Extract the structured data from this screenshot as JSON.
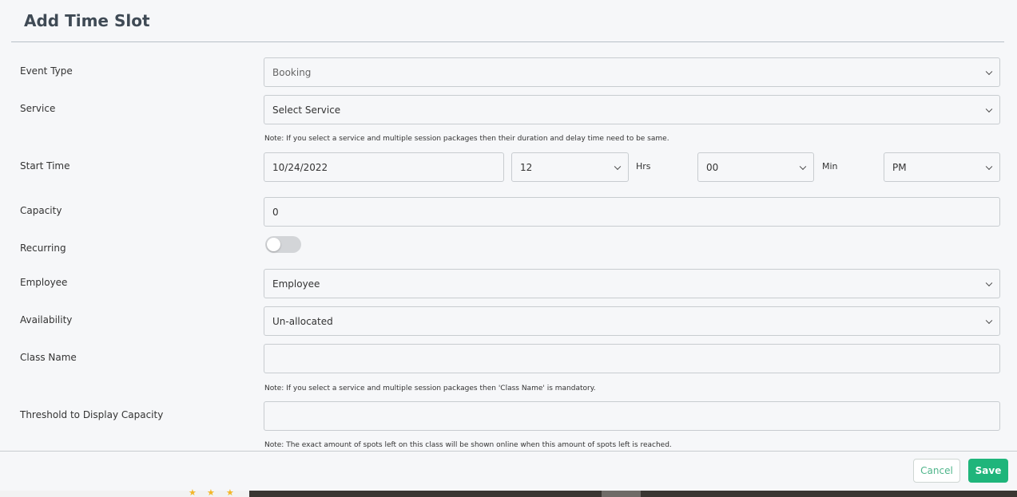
{
  "modal": {
    "title": "Add Time Slot"
  },
  "form": {
    "event_type": {
      "label": "Event Type",
      "value": "Booking"
    },
    "service": {
      "label": "Service",
      "value": "Select Service",
      "note": "Note: If you select a service and multiple session packages then their duration and delay time need to be same."
    },
    "start_time": {
      "label": "Start Time",
      "date": "10/24/2022",
      "hour": "12",
      "hour_unit": "Hrs",
      "minute": "00",
      "minute_unit": "Min",
      "ampm": "PM"
    },
    "capacity": {
      "label": "Capacity",
      "value": "0"
    },
    "recurring": {
      "label": "Recurring",
      "enabled": false
    },
    "employee": {
      "label": "Employee",
      "value": "Employee"
    },
    "availability": {
      "label": "Availability",
      "value": "Un-allocated"
    },
    "class_name": {
      "label": "Class Name",
      "value": "",
      "note": "Note: If you select a service and multiple session packages then 'Class Name' is mandatory."
    },
    "threshold": {
      "label": "Threshold to Display Capacity",
      "value": "",
      "note": "Note: The exact amount of spots left on this class will be shown online when this amount of spots left is reached."
    }
  },
  "footer": {
    "cancel_label": "Cancel",
    "save_label": "Save"
  },
  "colors": {
    "primary": "#1fb57b",
    "background": "#f6f7f9",
    "border": "#c8ccd0"
  }
}
